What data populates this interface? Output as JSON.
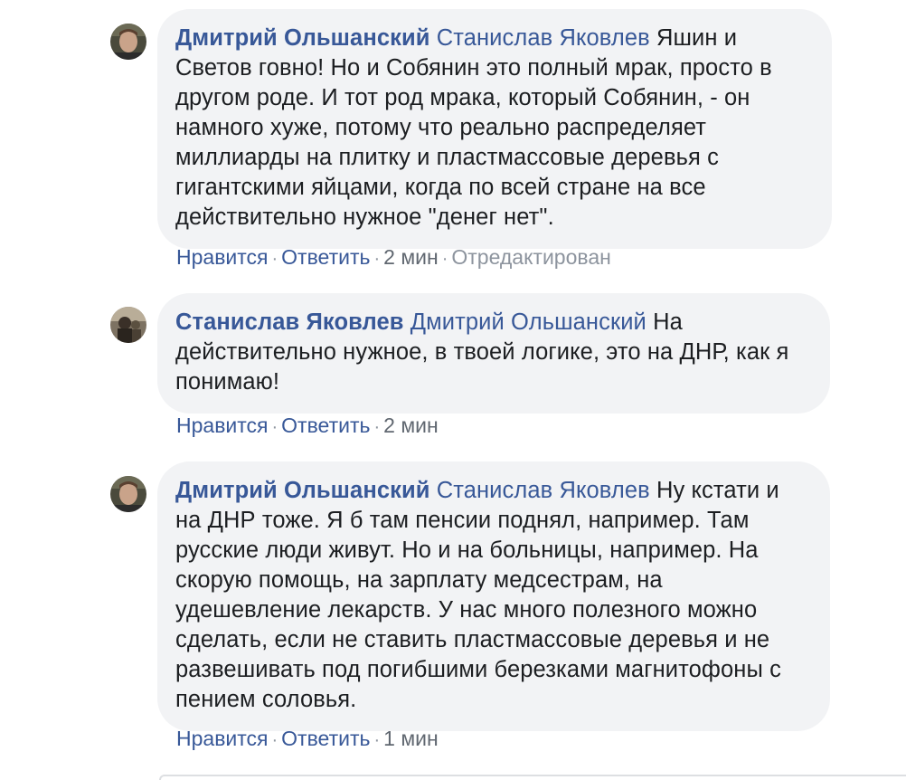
{
  "comments": [
    {
      "author": "Дмитрий Ольшанский",
      "mention": "Станислав Яковлев",
      "text": " Яшин и Светов говно! Но и Собянин это полный мрак, просто в другом роде. И тот род мрака, который Собянин, - он намного хуже, потому что реально распределяет миллиарды на плитку и пластмассовые деревья с гигантскими яйцами, когда по всей стране на все действительно нужное \"денег нет\".",
      "like": "Нравится",
      "reply": "Ответить",
      "time": "2 мин",
      "edited": "Отредактирован"
    },
    {
      "author": "Станислав Яковлев",
      "mention": "Дмитрий Ольшанский",
      "text": " На действительно нужное, в твоей логике, это на ДНР, как я понимаю!",
      "like": "Нравится",
      "reply": "Ответить",
      "time": "2 мин"
    },
    {
      "author": "Дмитрий Ольшанский",
      "mention": "Станислав Яковлев",
      "text": " Ну кстати и на ДНР тоже. Я б там пенсии поднял, например. Там русские люди живут. Но и на больницы, например. На скорую помощь, на зарплату медсестрам, на удешевление лекарств. У нас много полезного можно сделать, если не ставить пластмассовые деревья и не развешивать под погибшими березками магнитофоны с пением соловья.",
      "like": "Нравится",
      "reply": "Ответить",
      "time": "1 мин"
    }
  ],
  "separator": "·",
  "colors": {
    "link": "#385898",
    "bubble": "#f2f3f5",
    "text": "#1c1e21",
    "meta": "#606770"
  }
}
